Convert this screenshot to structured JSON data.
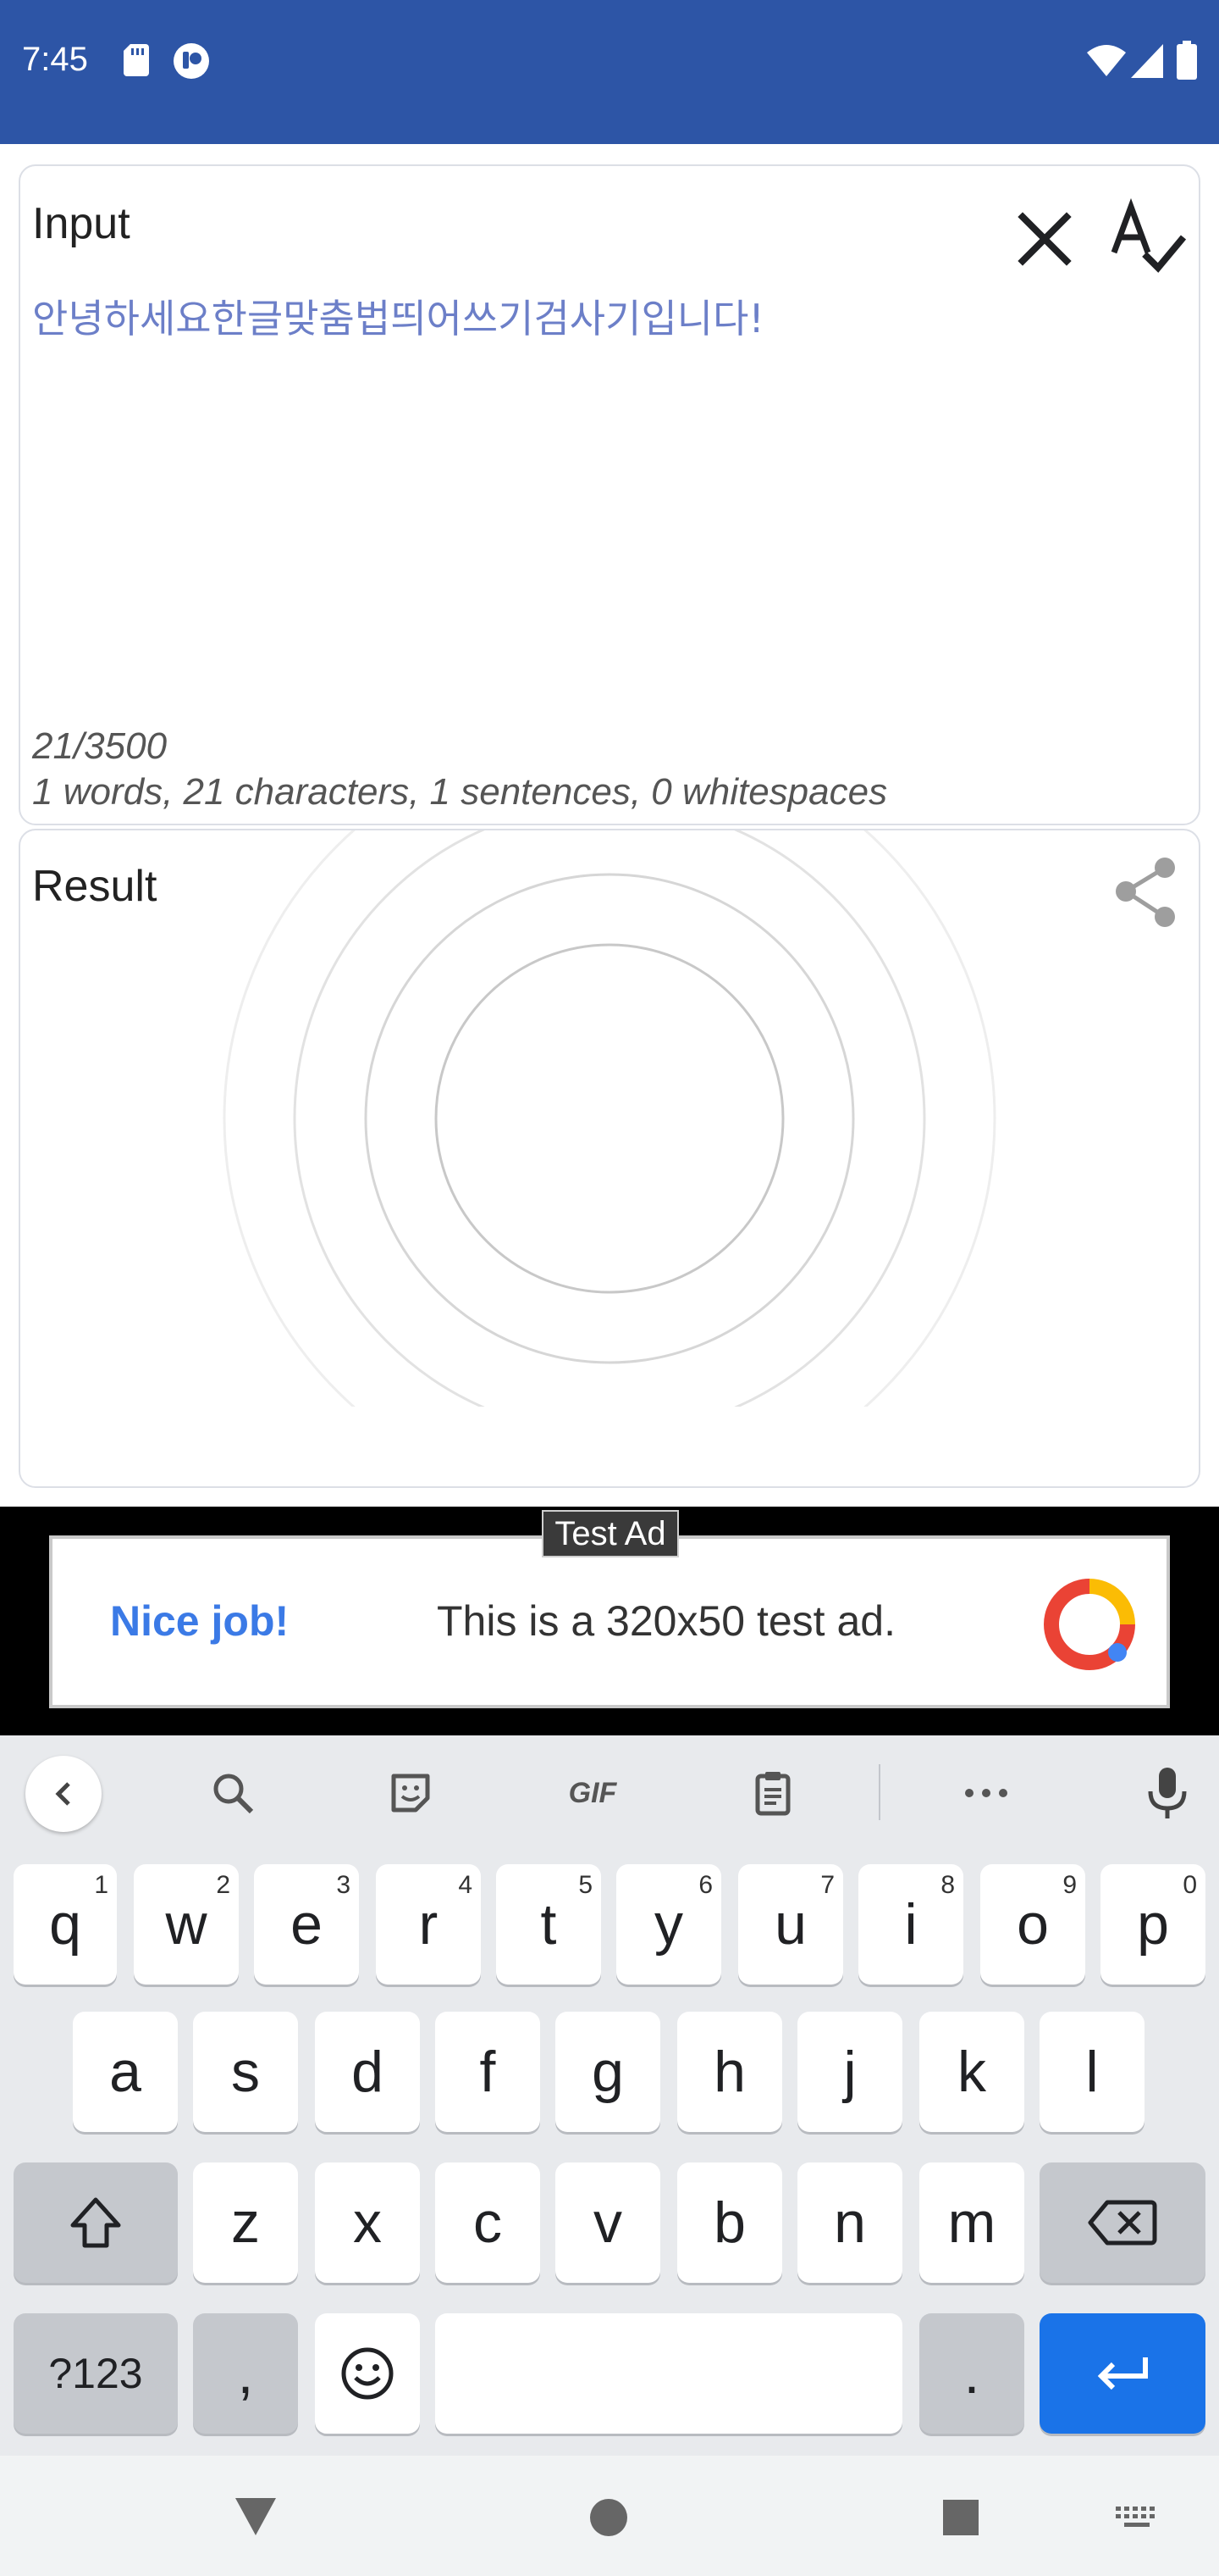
{
  "status_bar": {
    "time": "7:45",
    "left_icons": [
      "sd-card-icon",
      "app-notification-icon"
    ],
    "right_icons": [
      "wifi-icon",
      "cell-signal-icon",
      "battery-icon"
    ],
    "bg_color": "#2d55a6"
  },
  "input_card": {
    "title": "Input",
    "text": "안녕하세요한글맞춤법띄어쓰기검사기입니다!",
    "char_counter": "21/3500",
    "stats": "1 words, 21 characters, 1 sentences, 0 whitespaces",
    "clear_icon": "close-icon",
    "spellcheck_icon": "spellcheck-icon"
  },
  "result_card": {
    "title": "Result",
    "share_icon": "share-icon"
  },
  "ad": {
    "label": "Test Ad",
    "headline": "Nice job!",
    "description": "This is a 320x50 test ad."
  },
  "keyboard": {
    "toolbar": [
      "back-icon",
      "search-icon",
      "sticker-icon",
      "GIF",
      "clipboard-icon",
      "more-icon",
      "mic-icon"
    ],
    "row1": [
      {
        "label": "q",
        "hint": "1"
      },
      {
        "label": "w",
        "hint": "2"
      },
      {
        "label": "e",
        "hint": "3"
      },
      {
        "label": "r",
        "hint": "4"
      },
      {
        "label": "t",
        "hint": "5"
      },
      {
        "label": "y",
        "hint": "6"
      },
      {
        "label": "u",
        "hint": "7"
      },
      {
        "label": "i",
        "hint": "8"
      },
      {
        "label": "o",
        "hint": "9"
      },
      {
        "label": "p",
        "hint": "0"
      }
    ],
    "row2": [
      "a",
      "s",
      "d",
      "f",
      "g",
      "h",
      "j",
      "k",
      "l"
    ],
    "row3": [
      "z",
      "x",
      "c",
      "v",
      "b",
      "n",
      "m"
    ],
    "row4": {
      "symbols": "?123",
      "comma": ",",
      "period": "."
    },
    "enter_color": "#1a73e8"
  },
  "nav_bar": [
    "back-triangle-icon",
    "home-circle-icon",
    "recents-square-icon",
    "keyboard-switch-icon"
  ]
}
